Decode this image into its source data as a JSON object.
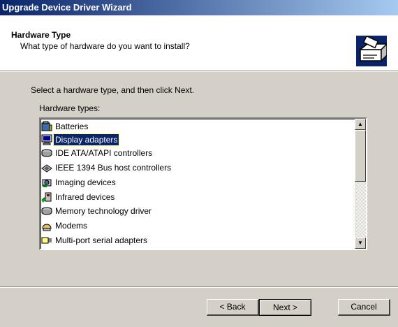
{
  "window": {
    "title": "Upgrade Device Driver Wizard"
  },
  "header": {
    "title": "Hardware Type",
    "subtitle": "What type of hardware do you want to install?",
    "icon": "hardware-wizard-icon"
  },
  "main": {
    "instruction": "Select a hardware type, and then click Next.",
    "list_label": "Hardware types:",
    "selected_index": 1,
    "items": [
      {
        "label": "Batteries",
        "icon": "battery-icon"
      },
      {
        "label": "Display adapters",
        "icon": "monitor-icon"
      },
      {
        "label": "IDE ATA/ATAPI controllers",
        "icon": "disk-controller-icon"
      },
      {
        "label": "IEEE 1394 Bus host controllers",
        "icon": "ieee1394-icon"
      },
      {
        "label": "Imaging devices",
        "icon": "camera-icon"
      },
      {
        "label": "Infrared devices",
        "icon": "infrared-icon"
      },
      {
        "label": "Memory technology driver",
        "icon": "memory-icon"
      },
      {
        "label": "Modems",
        "icon": "modem-icon"
      },
      {
        "label": "Multi-port serial adapters",
        "icon": "serial-port-icon"
      }
    ]
  },
  "buttons": {
    "back": "< Back",
    "next": "Next >",
    "cancel": "Cancel"
  },
  "colors": {
    "title_start": "#0a246a",
    "title_end": "#a6caf0",
    "selection": "#0a246a",
    "face": "#d4d0c8"
  }
}
